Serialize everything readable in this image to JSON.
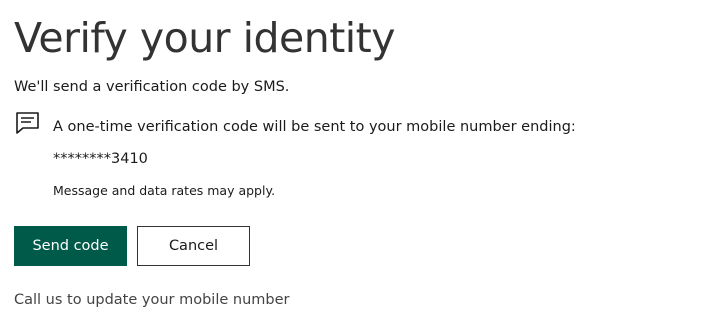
{
  "page": {
    "title": "Verify your identity",
    "subtitle": "We'll send a verification code by SMS."
  },
  "notice": {
    "icon": "message-icon",
    "text": "A one-time verification code will be sent to your mobile number ending:",
    "masked_number": "********3410",
    "rates_note": "Message and data rates may apply."
  },
  "actions": {
    "send_label": "Send code",
    "cancel_label": "Cancel"
  },
  "footer": {
    "call_link": "Call us to update your mobile number"
  },
  "colors": {
    "primary": "#005a49",
    "text": "#1b1b1b",
    "title": "#333333"
  }
}
